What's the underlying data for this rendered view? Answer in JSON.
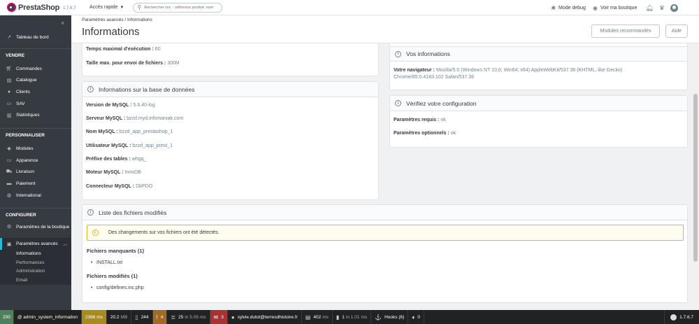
{
  "header": {
    "brand": "PrestaShop",
    "version": "1.7.6.7",
    "quick_access": "Accès rapide",
    "search_placeholder": "Rechercher (ex. : référence produit, nom",
    "debug_mode": "Mode debug",
    "view_shop": "Voir ma boutique"
  },
  "sidebar": {
    "dashboard": "Tableau de bord",
    "sections": {
      "sell": "VENDRE",
      "customize": "PERSONNALISER",
      "configure": "CONFIGURER"
    },
    "sell_items": [
      "Commandes",
      "Catalogue",
      "Clients",
      "SAV",
      "Statistiques"
    ],
    "customize_items": [
      "Modules",
      "Apparence",
      "Livraison",
      "Paiement",
      "International"
    ],
    "configure_items": [
      "Paramètres de la boutique",
      "Paramètres avancés"
    ],
    "sub_items": [
      "Informations",
      "Performances",
      "Administration",
      "Email"
    ]
  },
  "page": {
    "breadcrumb": "Paramètres avancés  /  Informations",
    "title": "Informations",
    "btn_modules": "Modules recommandés",
    "btn_help": "Aide"
  },
  "server": {
    "exec_label": "Temps maximal d'exécution :",
    "exec_value": "60",
    "upload_label": "Taille max. pour envoi de fichiers :",
    "upload_value": "300M"
  },
  "mysql": {
    "title": "Informations sur la base de données",
    "rows": [
      {
        "label": "Version de MySQL :",
        "value": "5.6.40-log"
      },
      {
        "label": "Serveur MySQL :",
        "value": "bzzd.myd.infomaniak.com"
      },
      {
        "label": "Nom MySQL :",
        "value": "bzzd_app_prestashop_1"
      },
      {
        "label": "Utilisateur MySQL :",
        "value": "bzzd_app_prest_1"
      },
      {
        "label": "Préfixe des tables :",
        "value": "whgq_"
      },
      {
        "label": "Moteur MySQL :",
        "value": "InnoDB"
      },
      {
        "label": "Connecteur MySQL :",
        "value": "DbPDO"
      }
    ]
  },
  "vos": {
    "title": "Vos informations",
    "browser_label": "Votre navigateur :",
    "browser_value": "Mozilla/5.0 (Windows NT 10.0; Win64; x64) AppleWebKit/537.36 (KHTML, like Gecko)",
    "browser_value2": "Chrome/85.0.4183.102 Safari/537.36"
  },
  "verif": {
    "title": "Vérifiez votre configuration",
    "req_label": "Paramètres requis :",
    "req_value": "ok",
    "opt_label": "Paramètres optionnels :",
    "opt_value": "ok"
  },
  "files": {
    "title": "Liste des fichiers modifiés",
    "alert": "Des changements sur vos fichiers ont été détectés.",
    "missing_label": "Fichiers manquants (1)",
    "missing_items": [
      "INSTALL.txt"
    ],
    "modified_label": "Fichiers modifiés (1)",
    "modified_items": [
      "config/defines.inc.php"
    ]
  },
  "debug": {
    "status": "200",
    "route": "@ admin_system_information",
    "time": "2366 ms",
    "memory": "20.2",
    "memory_unit": "MB",
    "files": "244",
    "warnings": "4",
    "queries": "25",
    "queries_time": "in 5.09",
    "queries_unit": "ms",
    "errors": "3",
    "user": "sylvie.dutot@terresdhistoire.fr",
    "mem2": "402",
    "mem2_unit": "ms",
    "cache": "1",
    "cache_time": "in 1.01",
    "cache_unit": "ms",
    "hooks": "Hooks (6)",
    "other": "0",
    "ps_version": "1.7.6.7"
  }
}
